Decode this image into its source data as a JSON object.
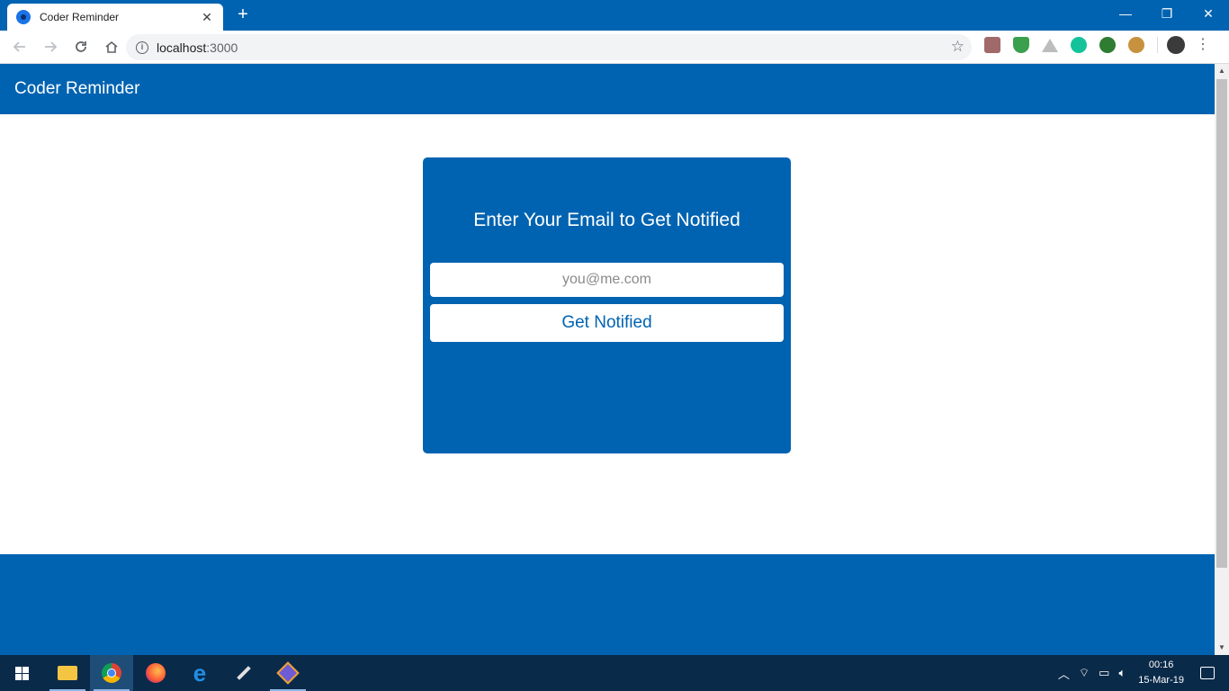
{
  "browser": {
    "tab_title": "Coder Reminder",
    "tab_close": "✕",
    "new_tab": "+",
    "url_host": "localhost",
    "url_port": ":3000",
    "window_controls": {
      "minimize": "—",
      "restore": "❐",
      "close": "✕"
    }
  },
  "app": {
    "title": "Coder Reminder"
  },
  "signup": {
    "heading": "Enter Your Email to Get Notified",
    "email_placeholder": "you@me.com",
    "email_value": "",
    "submit_label": "Get Notified"
  },
  "taskbar": {
    "time": "00:16",
    "date": "15-Mar-19"
  },
  "colors": {
    "brand_blue": "#0063b1",
    "white": "#ffffff",
    "taskbar": "#0a2a4a"
  }
}
